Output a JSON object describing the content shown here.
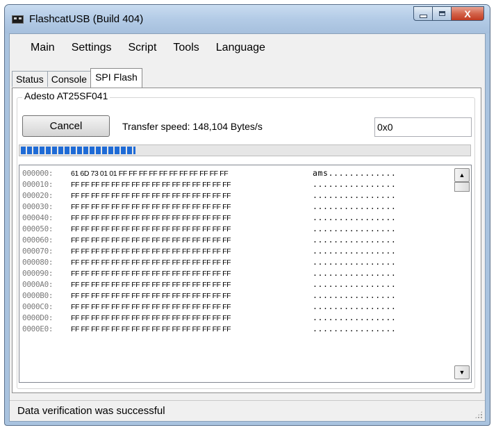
{
  "window": {
    "title": "FlashcatUSB (Build 404)",
    "caption_close": "X"
  },
  "menu": [
    "Main",
    "Settings",
    "Script",
    "Tools",
    "Language"
  ],
  "tabs": [
    {
      "label": "Status",
      "active": false
    },
    {
      "label": "Console",
      "active": false
    },
    {
      "label": "SPI Flash",
      "active": true
    }
  ],
  "spi": {
    "device_label": "Adesto AT25SF041",
    "cancel_label": "Cancel",
    "transfer_speed": "Transfer speed: 148,104 Bytes/s",
    "address_value": "0x0",
    "progress_percent": 26
  },
  "hex": {
    "lines": [
      {
        "addr": "000000:",
        "bytes": "61 6D 73 01 01 FF FF FF FF FF FF FF FF FF FF FF",
        "ascii": "ams............."
      },
      {
        "addr": "000010:",
        "bytes": "FF FF FF FF FF FF FF FF FF FF FF FF FF FF FF FF",
        "ascii": "................"
      },
      {
        "addr": "000020:",
        "bytes": "FF FF FF FF FF FF FF FF FF FF FF FF FF FF FF FF",
        "ascii": "................"
      },
      {
        "addr": "000030:",
        "bytes": "FF FF FF FF FF FF FF FF FF FF FF FF FF FF FF FF",
        "ascii": "................"
      },
      {
        "addr": "000040:",
        "bytes": "FF FF FF FF FF FF FF FF FF FF FF FF FF FF FF FF",
        "ascii": "................"
      },
      {
        "addr": "000050:",
        "bytes": "FF FF FF FF FF FF FF FF FF FF FF FF FF FF FF FF",
        "ascii": "................"
      },
      {
        "addr": "000060:",
        "bytes": "FF FF FF FF FF FF FF FF FF FF FF FF FF FF FF FF",
        "ascii": "................"
      },
      {
        "addr": "000070:",
        "bytes": "FF FF FF FF FF FF FF FF FF FF FF FF FF FF FF FF",
        "ascii": "................"
      },
      {
        "addr": "000080:",
        "bytes": "FF FF FF FF FF FF FF FF FF FF FF FF FF FF FF FF",
        "ascii": "................"
      },
      {
        "addr": "000090:",
        "bytes": "FF FF FF FF FF FF FF FF FF FF FF FF FF FF FF FF",
        "ascii": "................"
      },
      {
        "addr": "0000A0:",
        "bytes": "FF FF FF FF FF FF FF FF FF FF FF FF FF FF FF FF",
        "ascii": "................"
      },
      {
        "addr": "0000B0:",
        "bytes": "FF FF FF FF FF FF FF FF FF FF FF FF FF FF FF FF",
        "ascii": "................"
      },
      {
        "addr": "0000C0:",
        "bytes": "FF FF FF FF FF FF FF FF FF FF FF FF FF FF FF FF",
        "ascii": "................"
      },
      {
        "addr": "0000D0:",
        "bytes": "FF FF FF FF FF FF FF FF FF FF FF FF FF FF FF FF",
        "ascii": "................"
      },
      {
        "addr": "0000E0:",
        "bytes": "FF FF FF FF FF FF FF FF FF FF FF FF FF FF FF FF",
        "ascii": "................"
      }
    ]
  },
  "status": {
    "text": "Data verification was successful"
  },
  "icons": {
    "app": "flashcat-app-icon",
    "scroll_up": "scroll-up-arrow-icon",
    "scroll_down": "scroll-down-arrow-icon",
    "grip": "resize-grip-icon"
  }
}
